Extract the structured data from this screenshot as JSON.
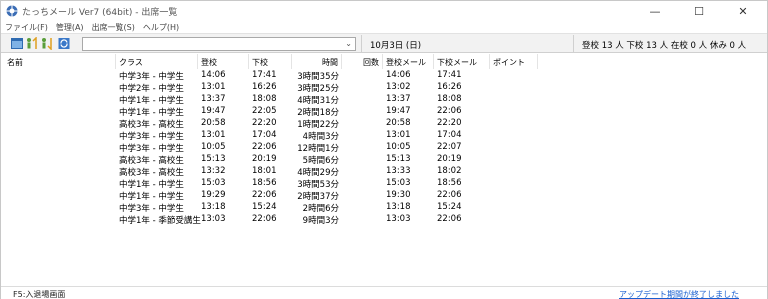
{
  "window": {
    "title": "たっちメール Ver7 (64bit) - 出席一覧",
    "minimize": "—",
    "maximize": "☐",
    "close": "✕"
  },
  "menu": [
    "ファイル(F)",
    "管理(A)",
    "出席一覧(S)",
    "ヘルプ(H)"
  ],
  "toolbar": {
    "combo_value": "",
    "date": "10月3日 (日)",
    "status": "登校 13 人  下校 13 人  在校 0 人  休み 0 人",
    "icons": [
      "window-icon",
      "checkin-icon",
      "checkout-icon",
      "refresh-icon"
    ]
  },
  "table": {
    "headers": [
      "名前",
      "クラス",
      "登校",
      "下校",
      "時間",
      "回数",
      "登校メール",
      "下校メール",
      "ポイント"
    ],
    "rows": [
      {
        "cls": "中学3年 - 中学生",
        "in": "14:06",
        "out": "17:41",
        "time": "3時間35分",
        "mail_in": "14:06",
        "mail_out": "17:41"
      },
      {
        "cls": "中学2年 - 中学生",
        "in": "13:01",
        "out": "16:26",
        "time": "3時間25分",
        "mail_in": "13:02",
        "mail_out": "16:26"
      },
      {
        "cls": "中学1年 - 中学生",
        "in": "13:37",
        "out": "18:08",
        "time": "4時間31分",
        "mail_in": "13:37",
        "mail_out": "18:08"
      },
      {
        "cls": "中学1年 - 中学生",
        "in": "19:47",
        "out": "22:05",
        "time": "2時間18分",
        "mail_in": "19:47",
        "mail_out": "22:06"
      },
      {
        "cls": "高校3年 - 高校生",
        "in": "20:58",
        "out": "22:20",
        "time": "1時間22分",
        "mail_in": "20:58",
        "mail_out": "22:20"
      },
      {
        "cls": "中学3年 - 中学生",
        "in": "13:01",
        "out": "17:04",
        "time": "4時間3分",
        "mail_in": "13:01",
        "mail_out": "17:04"
      },
      {
        "cls": "中学3年 - 中学生",
        "in": "10:05",
        "out": "22:06",
        "time": "12時間1分",
        "mail_in": "10:05",
        "mail_out": "22:07"
      },
      {
        "cls": "高校3年 - 高校生",
        "in": "15:13",
        "out": "20:19",
        "time": "5時間6分",
        "mail_in": "15:13",
        "mail_out": "20:19"
      },
      {
        "cls": "高校3年 - 高校生",
        "in": "13:32",
        "out": "18:01",
        "time": "4時間29分",
        "mail_in": "13:33",
        "mail_out": "18:02"
      },
      {
        "cls": "中学1年 - 中学生",
        "in": "15:03",
        "out": "18:56",
        "time": "3時間53分",
        "mail_in": "15:03",
        "mail_out": "18:56"
      },
      {
        "cls": "中学1年 - 中学生",
        "in": "19:29",
        "out": "22:06",
        "time": "2時間37分",
        "mail_in": "19:30",
        "mail_out": "22:06"
      },
      {
        "cls": "中学3年 - 中学生",
        "in": "13:18",
        "out": "15:24",
        "time": "2時間6分",
        "mail_in": "13:18",
        "mail_out": "15:24"
      },
      {
        "cls": "中学1年 - 季節受講生",
        "in": "13:03",
        "out": "22:06",
        "time": "9時間3分",
        "mail_in": "13:03",
        "mail_out": "22:06"
      }
    ]
  },
  "statusbar": {
    "left": "F5:入退場画面",
    "right": "アップデート期間が終了しました"
  },
  "colors": {
    "link": "#1a5fd0",
    "toolbar_bg": "#f2f2f2"
  }
}
